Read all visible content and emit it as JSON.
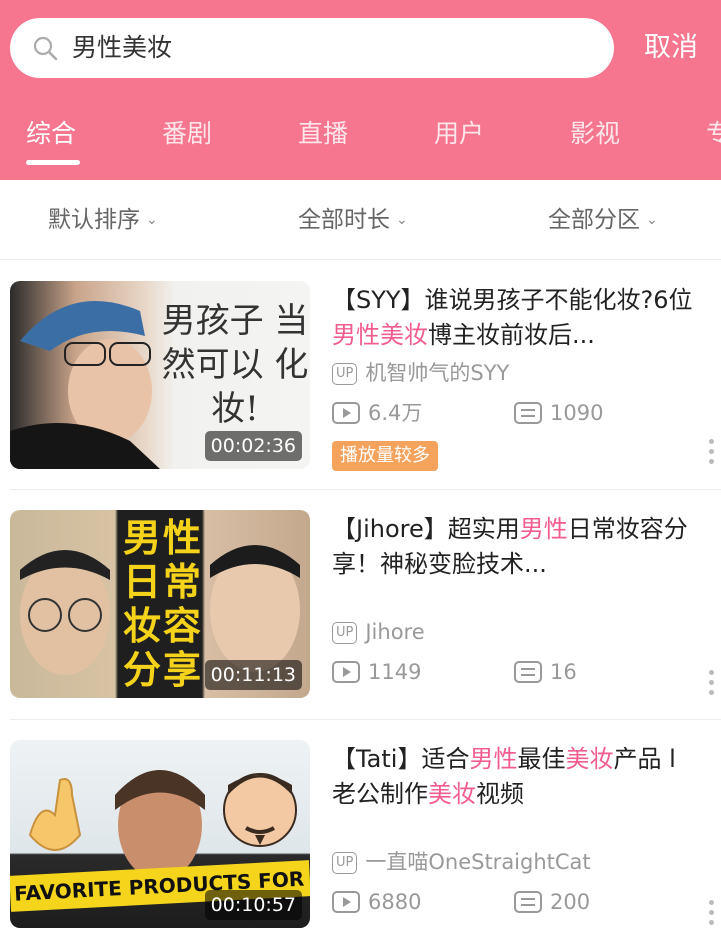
{
  "search": {
    "query": "男性美妆",
    "cancel_label": "取消"
  },
  "tabs": [
    {
      "label": "综合"
    },
    {
      "label": "番剧"
    },
    {
      "label": "直播"
    },
    {
      "label": "用户"
    },
    {
      "label": "影视"
    },
    {
      "label": "专"
    }
  ],
  "filters": [
    {
      "label": "默认排序"
    },
    {
      "label": "全部时长"
    },
    {
      "label": "全部分区"
    }
  ],
  "videos": [
    {
      "title_parts": [
        "【SYY】谁说男孩子不能化妆?6位",
        "男性美妆",
        "博主妆前妆后..."
      ],
      "thumb_text": "男孩子 当然可以 化妆!",
      "duration": "00:02:36",
      "up_badge": "UP",
      "uploader": "机智帅气的SYY",
      "plays": "6.4万",
      "danmaku": "1090",
      "tag": "播放量较多"
    },
    {
      "title_parts": [
        "【Jihore】超实用",
        "男性",
        "日常妆容分享！神秘变脸技术..."
      ],
      "thumb_text": "男性 日常 妆容 分享",
      "duration": "00:11:13",
      "up_badge": "UP",
      "uploader": "Jihore",
      "plays": "1149",
      "danmaku": "16"
    },
    {
      "title_parts": [
        "【Tati】适合",
        "男性",
        "最佳",
        "美妆",
        "产品 l 老公制作",
        "美妆",
        "视频"
      ],
      "thumb_text": "FAVORITE PRODUCTS FOR GUYS",
      "duration": "00:10:57",
      "up_badge": "UP",
      "uploader": "一直喵OneStraightCat",
      "plays": "6880",
      "danmaku": "200"
    }
  ],
  "colors": {
    "brand_pink": "#f6758f",
    "highlight": "#f25d8e",
    "tag_orange": "#f5a25d"
  }
}
